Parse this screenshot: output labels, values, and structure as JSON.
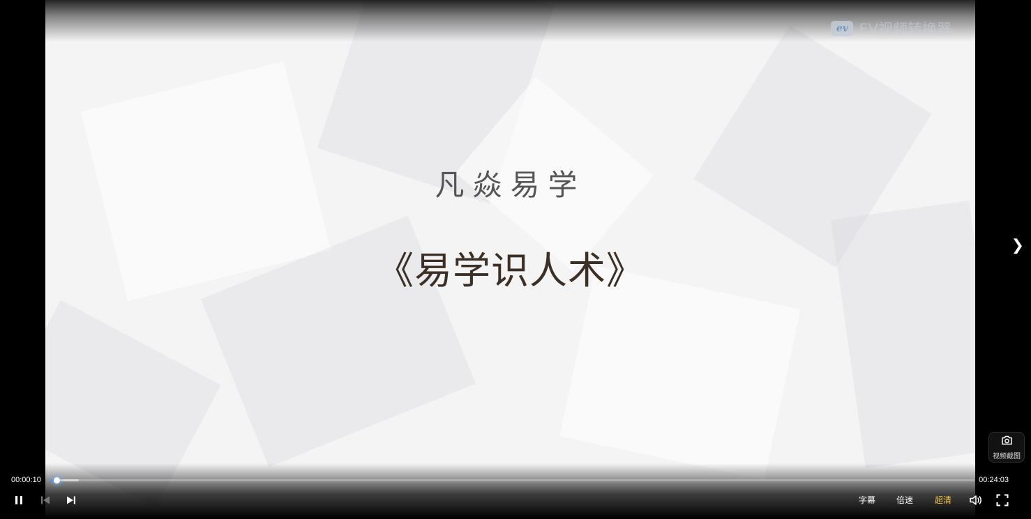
{
  "video": {
    "watermark_logo": "ev",
    "watermark_text": "EV视频转换器",
    "brand": "凡焱易学",
    "course_title": "《易学识人术》"
  },
  "player": {
    "current_time": "00:00:10",
    "total_time": "00:24:03",
    "progress_fraction": 0.007,
    "buffered_fraction": 0.031,
    "subtitle_label": "字幕",
    "speed_label": "倍速",
    "quality_label": "超清",
    "next_arrow": "❯",
    "snapshot_label": "视频截图",
    "colors": {
      "accent": "#3d8cff",
      "quality_active": "#f3c74c"
    },
    "icons": [
      "pause-icon",
      "prev-episode-icon",
      "next-episode-icon",
      "volume-icon",
      "fullscreen-icon",
      "camera-icon",
      "chevron-right-icon"
    ]
  }
}
